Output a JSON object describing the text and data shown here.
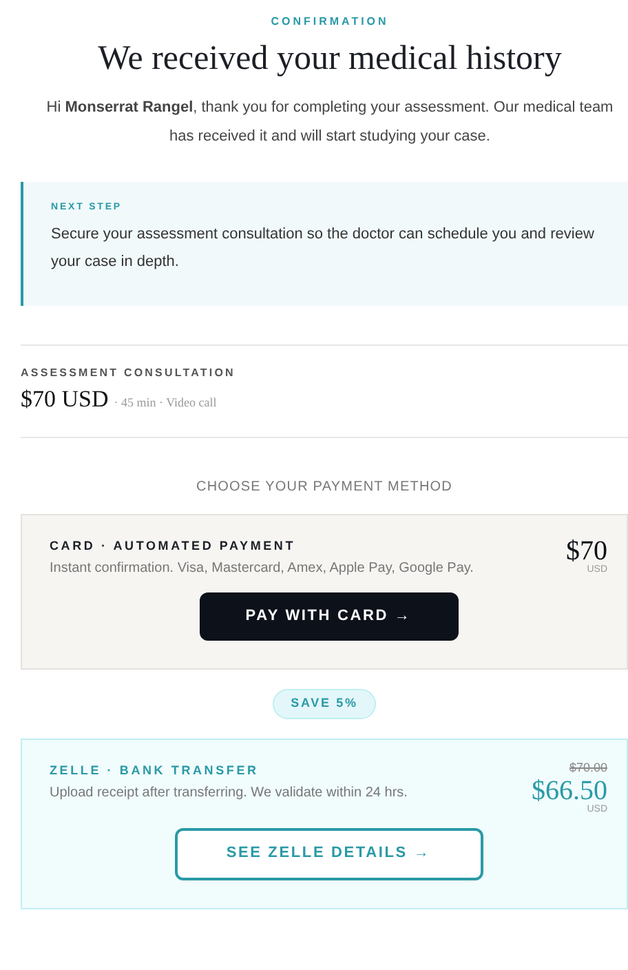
{
  "eyebrow": "CONFIRMATION",
  "title": "We received your medical history",
  "intro": "Hi **Monserrat Rangel**, thank you for completing your assessment. Our medical team has received it and will start studying your case.",
  "next_step": {
    "label": "NEXT STEP",
    "text": "Secure your assessment consultation so the doctor can schedule you and review your case in depth."
  },
  "consultation": {
    "label": "ASSESSMENT CONSULTATION",
    "price": "$70 USD",
    "details": "· 45 min · Video call"
  },
  "payment_heading": "CHOOSE YOUR PAYMENT METHOD",
  "methods": [
    {
      "kind": "card",
      "title": "CARD · AUTOMATED PAYMENT",
      "description": "Instant confirmation. Visa, Mastercard, Amex, Apple Pay, Google Pay.",
      "price": "$70",
      "currency": "USD",
      "button": "PAY WITH CARD →"
    },
    {
      "kind": "transfer",
      "badge": "SAVE 5%",
      "title": "ZELLE · BANK TRANSFER",
      "description": "Upload receipt after transferring. We validate within 24 hrs.",
      "old_price": "$70.00",
      "price": "$66.50",
      "currency": "USD",
      "button": "SEE ZELLE DETAILS →"
    }
  ]
}
